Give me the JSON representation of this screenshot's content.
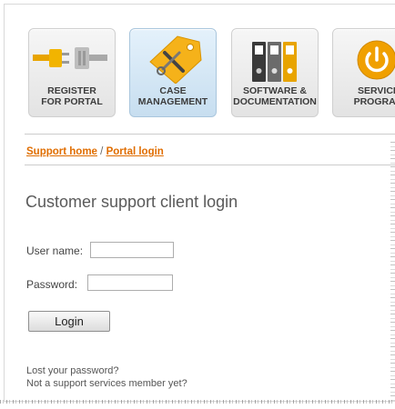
{
  "nav": {
    "tiles": [
      {
        "label": "REGISTER\nFOR PORTAL",
        "icon": "plug-icon"
      },
      {
        "label": "CASE\nMANAGEMENT",
        "icon": "tools-tag-icon"
      },
      {
        "label": "SOFTWARE &\nDOCUMENTATION",
        "icon": "binders-icon"
      },
      {
        "label": "SERVICE\nPROGRAM",
        "icon": "power-icon"
      }
    ],
    "active_index": 1
  },
  "breadcrumb": {
    "home": "Support home",
    "separator": "/",
    "current": "Portal login"
  },
  "login": {
    "title": "Customer support client login",
    "username_label": "User name:",
    "username_value": "",
    "password_label": "Password:",
    "password_value": "",
    "submit_label": "Login"
  },
  "links": {
    "lost_password": "Lost your password?",
    "not_member": "Not a support services member yet?"
  },
  "colors": {
    "link_orange": "#e06d00",
    "active_tile": "#c7def0"
  }
}
